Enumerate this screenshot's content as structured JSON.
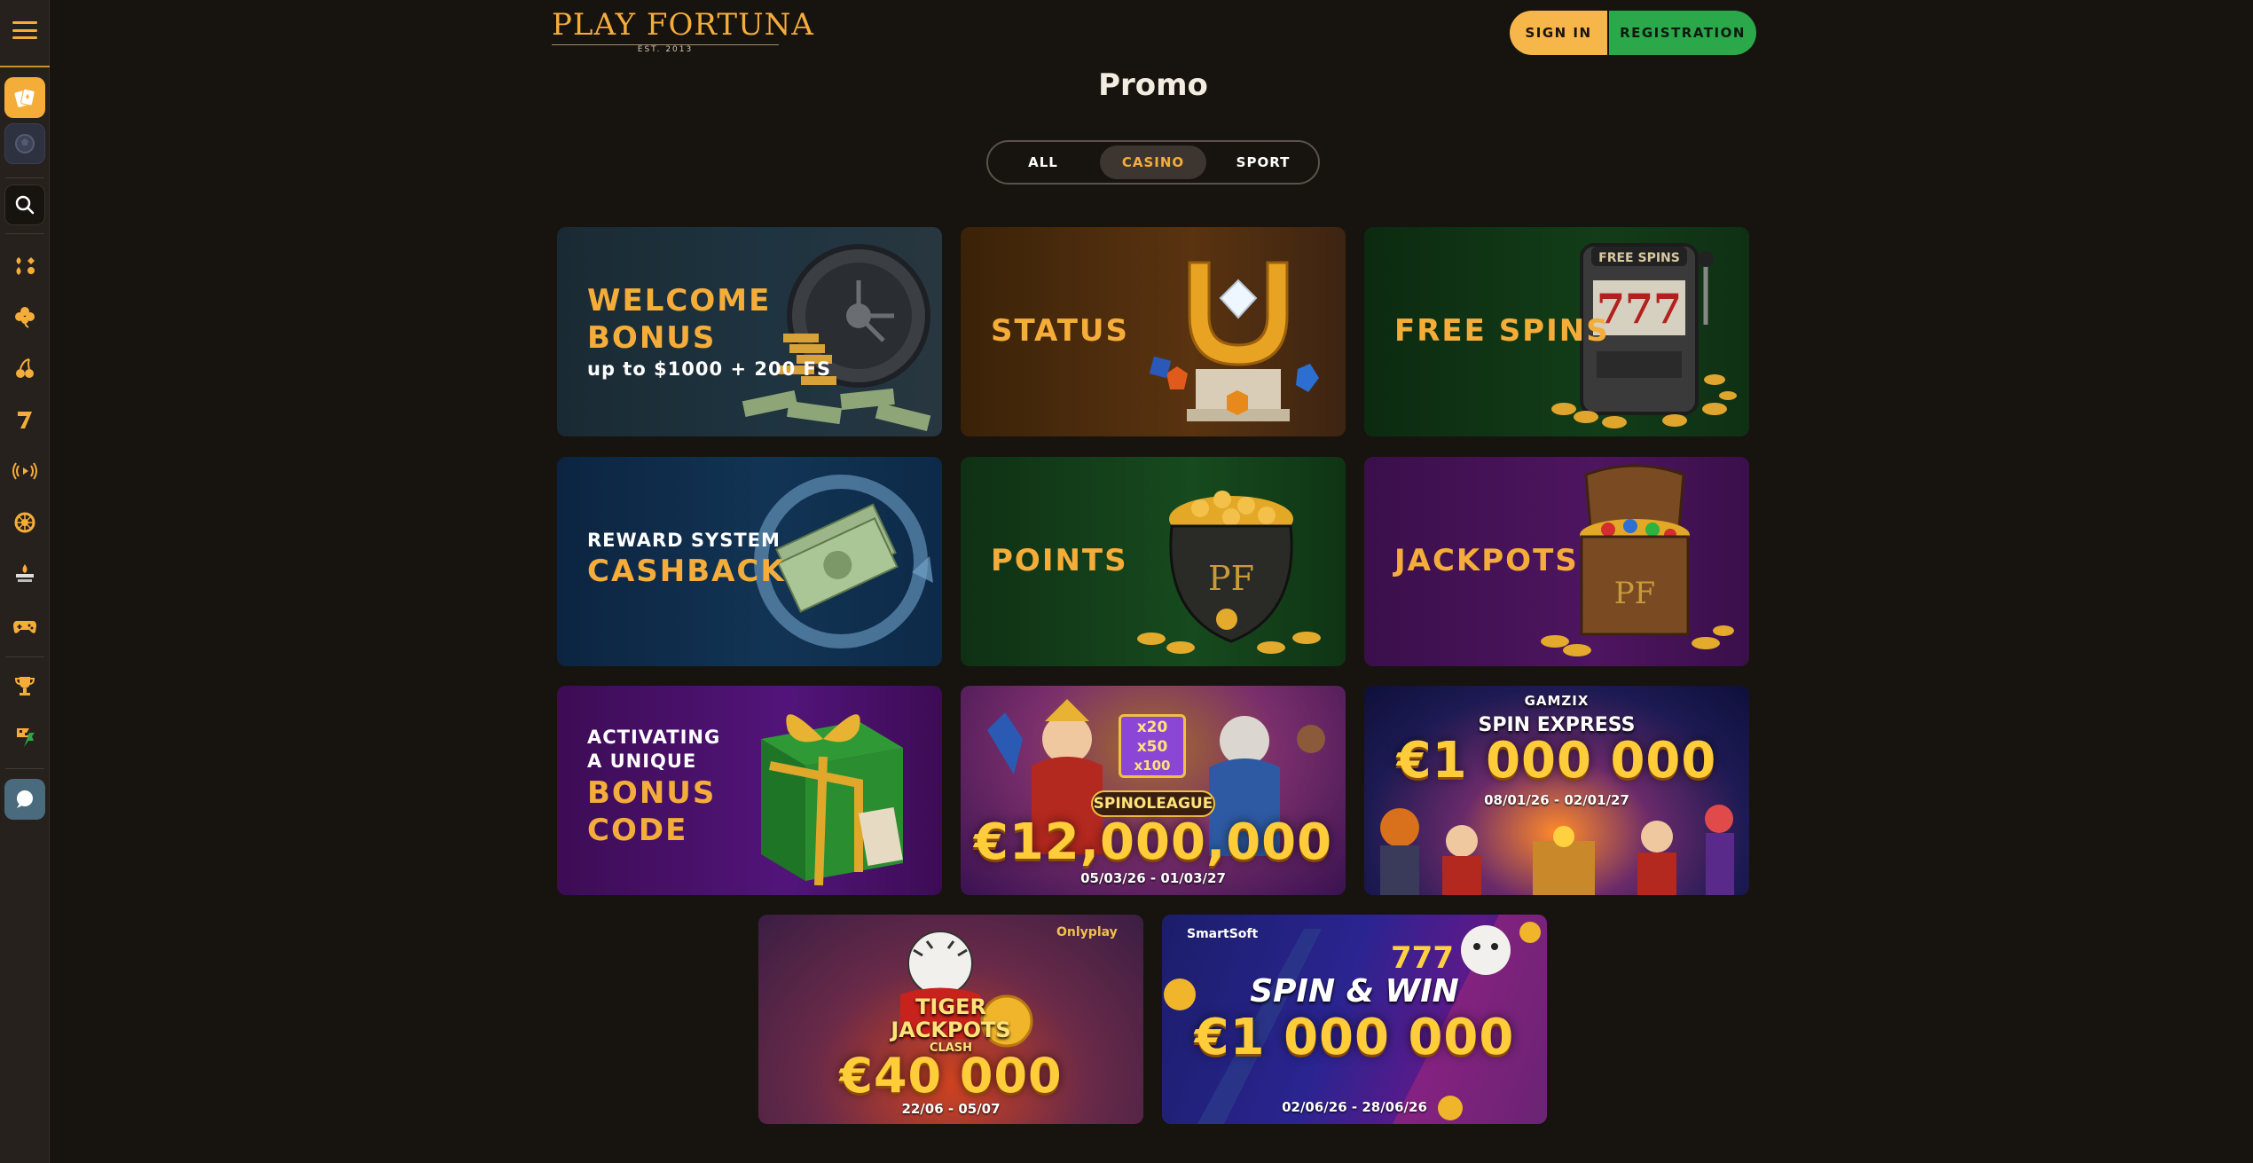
{
  "header": {
    "logo_text": "PLAY FORTUNA",
    "logo_est": "EST. 2013",
    "signin_label": "SIGN IN",
    "registration_label": "REGISTRATION"
  },
  "page": {
    "title": "Promo"
  },
  "tabs": [
    {
      "label": "ALL",
      "active": false
    },
    {
      "label": "CASINO",
      "active": true
    },
    {
      "label": "SPORT",
      "active": false
    }
  ],
  "sidebar": {
    "icons": [
      "cards-icon",
      "ball-icon",
      "search-icon",
      "suits-icon",
      "clover-icon",
      "cherry-icon",
      "seven-icon",
      "live-icon",
      "wheel-icon",
      "drops-wins-icon",
      "gamepad-icon",
      "trophy-icon",
      "flags-icon",
      "chat-icon"
    ]
  },
  "promos": {
    "welcome": {
      "title_line1": "WELCOME",
      "title_line2": "BONUS",
      "sub": "up to $1000 + 200 FS"
    },
    "status": {
      "title": "STATUS"
    },
    "free_spins": {
      "title": "FREE SPINS",
      "reel_sign": "FREE SPINS",
      "reels": "777"
    },
    "reward": {
      "sub": "REWARD SYSTEM",
      "title": "CASHBACK"
    },
    "points": {
      "title": "POINTS",
      "pot_label": "PF"
    },
    "jackpots": {
      "title": "JACKPOTS",
      "chest_label": "PF"
    },
    "bonus_code": {
      "line1": "ACTIVATING",
      "line2": "A UNIQUE",
      "line3": "BONUS",
      "line4": "CODE"
    },
    "spinoleague": {
      "multipliers": [
        "x20",
        "x50",
        "x100"
      ],
      "name": "SPINOLEAGUE",
      "amount": "€12,000,000",
      "dates": "05/03/26 - 01/03/27"
    },
    "spin_express": {
      "provider": "GAMZIX",
      "name": "SPIN EXPRESS",
      "amount": "€1 000 000",
      "dates": "08/01/26 - 02/01/27"
    },
    "tiger": {
      "provider": "Onlyplay",
      "name_line1": "TIGER",
      "name_line2": "JACKPOTS",
      "name_line3": "CLASH",
      "amount": "€40 000",
      "dates": "22/06 - 05/07"
    },
    "spin_win": {
      "provider": "SmartSoft",
      "name": "SPIN & WIN",
      "amount": "€1 000 000",
      "dates": "02/06/26 - 28/06/26",
      "sevens": "777"
    }
  },
  "colors": {
    "accent": "#f5ad3a",
    "register": "#2ba84a",
    "background": "#17130f",
    "sidebar": "#26211c"
  }
}
